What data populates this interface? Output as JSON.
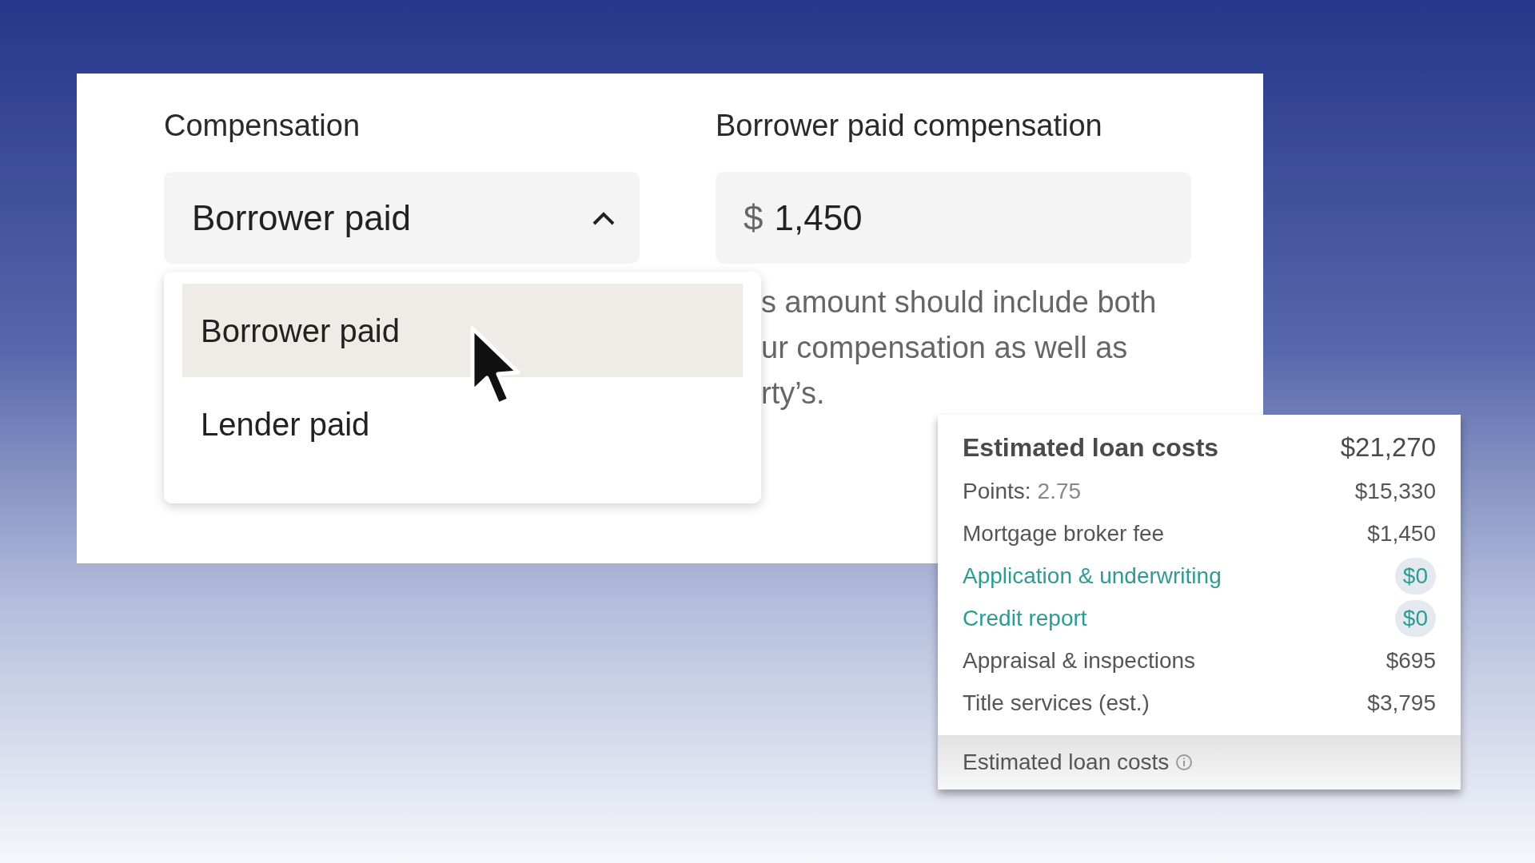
{
  "form": {
    "compensation": {
      "label": "Compensation",
      "value": "Borrower paid",
      "expanded": true,
      "options": [
        {
          "label": "Borrower paid",
          "selected": true
        },
        {
          "label": "Lender paid",
          "selected": false
        }
      ]
    },
    "amount": {
      "label": "Borrower paid compensation",
      "currency": "$",
      "value": "1,450"
    },
    "help_lines": [
      "s amount should include both",
      "ur compensation as well as",
      "rty’s."
    ]
  },
  "loan_costs": {
    "title": "Estimated loan costs",
    "total": "$21,270",
    "rows": [
      {
        "kind": "plain",
        "label": "Points:",
        "detail": "2.75",
        "value": "$15,330"
      },
      {
        "kind": "plain",
        "label": "Mortgage broker fee",
        "value": "$1,450"
      },
      {
        "kind": "link",
        "label": "Application & underwriting",
        "value": "$0"
      },
      {
        "kind": "link",
        "label": "Credit report",
        "value": "$0"
      },
      {
        "kind": "plain",
        "label": "Appraisal & inspections",
        "value": "$695"
      },
      {
        "kind": "plain",
        "label": "Title services (est.)",
        "value": "$3,795"
      }
    ],
    "footer": "Estimated loan costs"
  }
}
